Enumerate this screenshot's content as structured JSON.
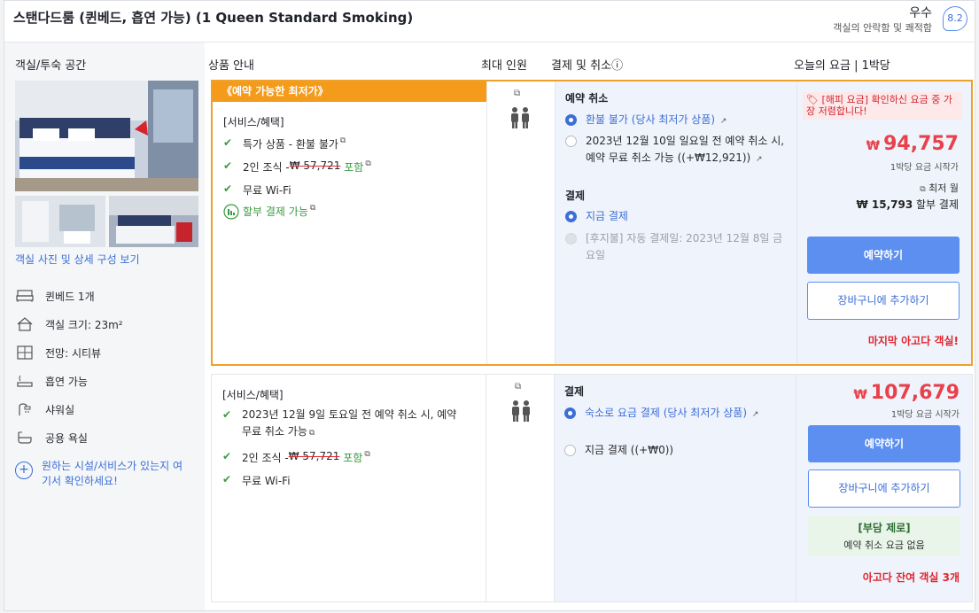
{
  "header": {
    "room_title": "스탠다드룸 (퀸베드, 흡연 가능) (1 Queen Standard Smoking)",
    "rating_word": "우수",
    "rating_sub": "객실의 안락함 및 쾌적함",
    "rating_score": "8.2"
  },
  "columns": {
    "room": "객실/투숙 공간",
    "product": "상품 안내",
    "max_guests": "최대 인원",
    "payment": "결제 및 취소ⓘ",
    "price": "오늘의 요금 | 1박당"
  },
  "left": {
    "photo_link": "객실 사진 및 상세 구성 보기",
    "amenities": [
      {
        "icon": "bed-icon",
        "label": "퀸베드 1개"
      },
      {
        "icon": "house-icon",
        "label": "객실 크기: 23m²"
      },
      {
        "icon": "window-icon",
        "label": "전망: 시티뷰"
      },
      {
        "icon": "smoking-icon",
        "label": "흡연 가능"
      },
      {
        "icon": "shower-icon",
        "label": "샤워실"
      },
      {
        "icon": "bath-icon",
        "label": "공용 욕실"
      }
    ],
    "more_facilities": "원하는 시설/서비스가 있는지 여기서 확인하세요!"
  },
  "offer1": {
    "best_tag": "《예약 가능한 최저가》",
    "benefits_title": "[서비스/혜택]",
    "benefit1": "특가 상품 - 환불 불가",
    "benefit2_prefix": "2인 조식 - ",
    "benefit2_strike": "₩ 57,721",
    "benefit2_incl": "포함",
    "benefit3": "무료 Wi-Fi",
    "installment": "할부 결제 가능",
    "cancel_title": "예약 취소",
    "cancel_opt1": "환불 불가 (당사 최저가 상품)",
    "cancel_opt2": "2023년 12월 10일 일요일 전 예약 취소 시, 예약 무료 취소 가능 ((+₩12,921))",
    "pay_title": "결제",
    "pay_opt1": "지금 결제",
    "pay_opt2": "[후지불] 자동 결제일: 2023년 12월 8일 금요일",
    "happy_note": "[해피 요금] 확인하신 요금 중 가장 저렴합니다!",
    "currency": "₩",
    "price": "94,757",
    "price_note": "1박당 요금 시작가",
    "min_monthly_label": "최저 월",
    "monthly": "₩ 15,793",
    "monthly_suffix": "할부 결제",
    "book_btn": "예약하기",
    "cart_btn": "장바구니에 추가하기",
    "last_room": "마지막 아고다 객실!"
  },
  "offer2": {
    "benefits_title": "[서비스/혜택]",
    "benefit1": "2023년 12월 9일 토요일 전 예약 취소 시, 예약 무료 취소 가능",
    "benefit2_prefix": "2인 조식 - ",
    "benefit2_strike": "₩ 57,721",
    "benefit2_incl": "포함",
    "benefit3": "무료 Wi-Fi",
    "pay_title": "결제",
    "pay_opt1": "숙소로 요금 결제 (당사 최저가 상품)",
    "pay_opt2": "지금 결제 ((+₩0))",
    "currency": "₩",
    "price": "107,679",
    "price_note": "1박당 요금 시작가",
    "book_btn": "예약하기",
    "cart_btn": "장바구니에 추가하기",
    "zero_title": "[부담 제로]",
    "zero_sub": "예약 취소 요금 없음",
    "rooms_left": "아고다 잔여 객실 3개"
  }
}
